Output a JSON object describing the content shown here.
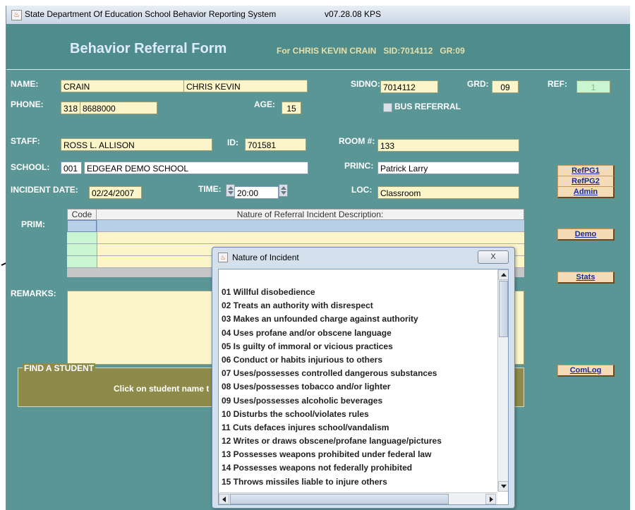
{
  "window": {
    "title": "State Department Of Education School Behavior Reporting System",
    "version": "v07.28.08 KPS"
  },
  "banner": {
    "title": "Behavior Referral Form",
    "subtitle": "For CHRIS KEVIN CRAIN   SID:7014112   GR:09"
  },
  "student": {
    "name_label": "NAME:",
    "last_name": "CRAIN",
    "first_name": "CHRIS KEVIN",
    "sidno_label": "SIDNO:",
    "sidno": "7014112",
    "grd_label": "GRD:",
    "grade": "09",
    "ref_label": "REF:",
    "ref": "1",
    "phone_label": "PHONE:",
    "area_code": "318",
    "phone": "8688000",
    "age_label": "AGE:",
    "age": "15",
    "bus_referral_label": "BUS REFERRAL",
    "bus_referral_checked": false
  },
  "staff": {
    "staff_label": "STAFF:",
    "staff_name": "ROSS L. ALLISON",
    "id_label": "ID:",
    "id": "701581",
    "room_label": "ROOM #:",
    "room": "133",
    "school_label": "SCHOOL:",
    "school_code": "001",
    "school_name": "EDGEAR DEMO SCHOOL",
    "princ_label": "PRINC:",
    "principal": "Patrick Larry",
    "incident_date_label": "INCIDENT DATE:",
    "incident_date": "02/24/2007",
    "time_label": "TIME:",
    "time": "20:00",
    "loc_label": "LOC:",
    "location": "Classroom"
  },
  "incident_table": {
    "prim_label": "PRIM:",
    "col_code": "Code",
    "col_description": "Nature of Referral Incident Description:"
  },
  "remarks_label": "REMARKS:",
  "finder": {
    "label": "FIND A STUDENT",
    "text": "Click on student name t"
  },
  "side_buttons": {
    "refpg1": "RefPG1",
    "refpg2": "RefPG2",
    "admin": "Admin",
    "demo": "Demo",
    "stats": "Stats",
    "comlog": "ComLog"
  },
  "dialog": {
    "title": "Nature of Incident",
    "close": "X",
    "items": [
      "01 Willful disobedience",
      "02 Treats an authority with disrespect",
      "03 Makes an unfounded charge against authority",
      "04 Uses profane and/or obscene language",
      "05 Is guilty of immoral or vicious practices",
      "06 Conduct or habits injurious to others",
      "07 Uses/possesses controlled dangerous substances",
      "08 Uses/possesses tobacco and/or lighter",
      "09 Uses/possesses alcoholic beverages",
      "10 Disturbs the school/violates rules",
      "11 Cuts defaces injures school/vandalism",
      "12 Writes or draws obscene/profane language/pictures",
      "13 Possesses weapons prohibited under federal law",
      "14 Possesses weapons not federally prohibited",
      "15 Throws missiles liable to injure others"
    ]
  }
}
